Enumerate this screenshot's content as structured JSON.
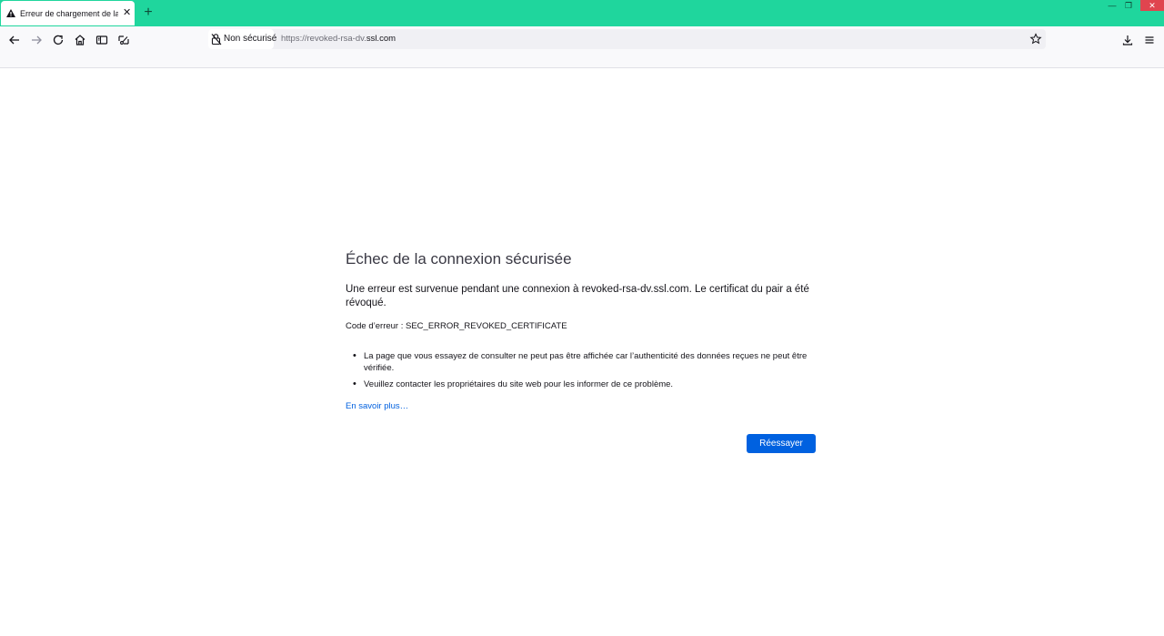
{
  "tab": {
    "title": "Erreur de chargement de la page",
    "close": "✕"
  },
  "new_tab_label": "+",
  "window": {
    "minimize": "—",
    "maximize": "❐",
    "close": "✕"
  },
  "toolbar": {
    "back_icon": "arrow-left-icon",
    "forward_icon": "arrow-right-icon",
    "reload_icon": "reload-icon",
    "home_icon": "home-icon",
    "reader_icon": "sidebar-icon",
    "extensions_icon": "screenshot-icon"
  },
  "urlbar": {
    "security_label": "Non sécurisé",
    "url_prefix": "https://revoked-rsa-dv.",
    "url_domain": "ssl.com"
  },
  "error": {
    "title": "Échec de la connexion sécurisée",
    "description": "Une erreur est survenue pendant une connexion à revoked-rsa-dv.ssl.com. Le certificat du pair a été révoqué.",
    "code": "Code d’erreur : SEC_ERROR_REVOKED_CERTIFICATE",
    "bullets": [
      "La page que vous essayez de consulter ne peut pas être affichée car l’authenticité des données reçues ne peut être vérifiée.",
      "Veuillez contacter les propriétaires du site web pour les informer de ce problème."
    ],
    "learn_more": "En savoir plus…",
    "retry": "Réessayer"
  },
  "colors": {
    "tabbar": "#1fd69d",
    "accent": "#0061e0",
    "link": "#0060df",
    "close_button": "#e0454f"
  }
}
